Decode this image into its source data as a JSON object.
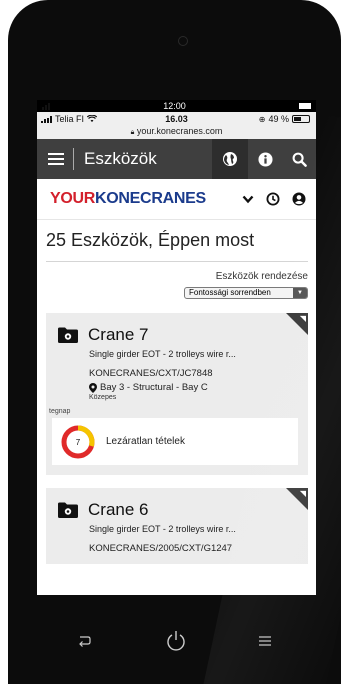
{
  "status_bar": {
    "time": "12:00"
  },
  "ios_bar": {
    "carrier": "Telia FI",
    "time": "16.03",
    "battery": "49 %",
    "url": "your.konecranes.com"
  },
  "header": {
    "title": "Eszközök",
    "icons": [
      "menu-icon",
      "globe-icon",
      "info-icon",
      "search-icon"
    ]
  },
  "brand": {
    "your": "YOUR",
    "name": "KONECRANES",
    "icons": [
      "chevron-down-icon",
      "clock-icon",
      "user-icon"
    ]
  },
  "page": {
    "heading": "25 Eszközök, Éppen most",
    "sort_label": "Eszközök rendezése",
    "sort_value": "Fontossági sorrendben"
  },
  "cards": [
    {
      "title": "Crane 7",
      "subtitle": "Single girder EOT - 2 trolleys wire r...",
      "code": "KONECRANES/CXT/JC7848",
      "location": "Bay 3 - Structural - Bay C",
      "criticality": "Közepes",
      "date_label": "tegnap",
      "issue_count": "7",
      "issue_label": "Lezáratlan tételek"
    },
    {
      "title": "Crane 6",
      "subtitle": "Single girder EOT - 2 trolleys wire r...",
      "code": "KONECRANES/2005/CXT/G1247"
    }
  ],
  "colors": {
    "header_bg": "#3f3f3f",
    "brand_red": "#d3202c",
    "brand_blue": "#1b3b8c",
    "card_bg": "#ececec",
    "donut_red": "#e02a2a",
    "donut_yellow": "#f5c400"
  },
  "nav_icons": [
    "back-icon",
    "power-icon",
    "recent-apps-icon"
  ]
}
